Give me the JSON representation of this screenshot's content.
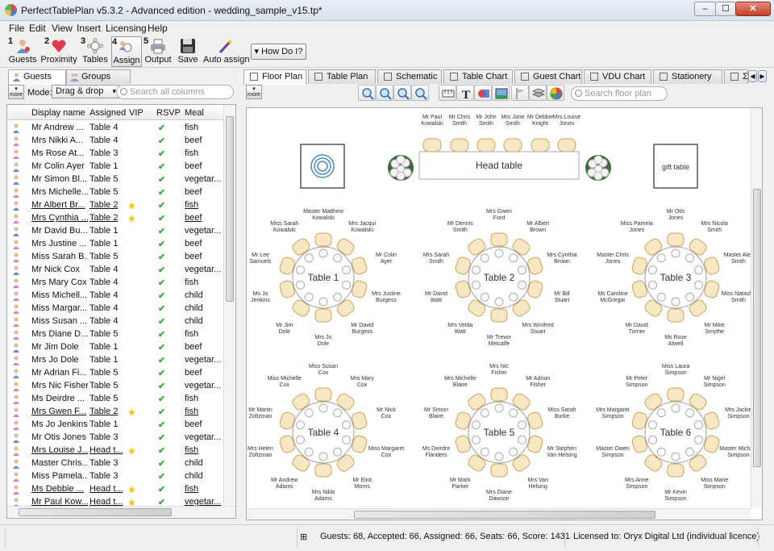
{
  "window": {
    "title": "PerfectTablePlan v5.3.2 - Advanced edition - wedding_sample_v15.tp*"
  },
  "menu": [
    "File",
    "Edit",
    "View",
    "Insert",
    "Licensing",
    "Help"
  ],
  "toolbar": [
    {
      "num": "1",
      "label": "Guests"
    },
    {
      "num": "2",
      "label": "Proximity"
    },
    {
      "num": "3",
      "label": "Tables"
    },
    {
      "num": "4",
      "label": "Assign"
    },
    {
      "num": "5",
      "label": "Output"
    },
    {
      "num": "",
      "label": "Save"
    },
    {
      "num": "",
      "label": "Auto assign"
    }
  ],
  "how_do_i": "▾ How Do I?",
  "left": {
    "tabs": [
      "Guests",
      "Groups"
    ],
    "more": "more",
    "mode_label": "Mode:",
    "mode_value": "Drag & drop",
    "search_placeholder": "Search all columns",
    "columns": [
      "Display name",
      "Assigned",
      "VIP",
      "RSVP",
      "Meal"
    ],
    "rows": [
      {
        "name": "Mr Andrew ...",
        "assigned": "Table 4",
        "vip": false,
        "meal": "fish",
        "gender": "m"
      },
      {
        "name": "Mrs Nikki A...",
        "assigned": "Table 4",
        "vip": false,
        "meal": "beef",
        "gender": "f"
      },
      {
        "name": "Ms Rose At...",
        "assigned": "Table 3",
        "vip": false,
        "meal": "fish",
        "gender": "f"
      },
      {
        "name": "Mr Colin Ayer",
        "assigned": "Table 1",
        "vip": false,
        "meal": "beef",
        "gender": "m"
      },
      {
        "name": "Mr Simon Bl...",
        "assigned": "Table 5",
        "vip": false,
        "meal": "vegetar...",
        "gender": "m"
      },
      {
        "name": "Mrs Michelle...",
        "assigned": "Table 5",
        "vip": false,
        "meal": "beef",
        "gender": "f"
      },
      {
        "name": "Mr Albert Br...",
        "assigned": "Table 2",
        "vip": true,
        "meal": "fish",
        "gender": "m",
        "u": true
      },
      {
        "name": "Mrs Cynthia ...",
        "assigned": "Table 2",
        "vip": true,
        "meal": "beef",
        "gender": "f",
        "u": true
      },
      {
        "name": "Mr David Bu...",
        "assigned": "Table 1",
        "vip": false,
        "meal": "vegetar...",
        "gender": "m"
      },
      {
        "name": "Mrs Justine ...",
        "assigned": "Table 1",
        "vip": false,
        "meal": "beef",
        "gender": "f"
      },
      {
        "name": "Miss Sarah B...",
        "assigned": "Table 5",
        "vip": false,
        "meal": "beef",
        "gender": "f"
      },
      {
        "name": "Mr Nick Cox",
        "assigned": "Table 4",
        "vip": false,
        "meal": "vegetar...",
        "gender": "m"
      },
      {
        "name": "Mrs Mary Cox",
        "assigned": "Table 4",
        "vip": false,
        "meal": "fish",
        "gender": "f"
      },
      {
        "name": "Miss Michell...",
        "assigned": "Table 4",
        "vip": false,
        "meal": "child",
        "gender": "f"
      },
      {
        "name": "Miss Margar...",
        "assigned": "Table 4",
        "vip": false,
        "meal": "child",
        "gender": "f"
      },
      {
        "name": "Miss Susan ...",
        "assigned": "Table 4",
        "vip": false,
        "meal": "child",
        "gender": "f"
      },
      {
        "name": "Mrs Diane D...",
        "assigned": "Table 5",
        "vip": false,
        "meal": "fish",
        "gender": "f"
      },
      {
        "name": "Mr Jim Dole",
        "assigned": "Table 1",
        "vip": false,
        "meal": "beef",
        "gender": "m"
      },
      {
        "name": "Mrs Jo Dole",
        "assigned": "Table 1",
        "vip": false,
        "meal": "vegetar...",
        "gender": "f"
      },
      {
        "name": "Mr Adrian Fi...",
        "assigned": "Table 5",
        "vip": false,
        "meal": "beef",
        "gender": "m"
      },
      {
        "name": "Mrs Nic Fisher",
        "assigned": "Table 5",
        "vip": false,
        "meal": "vegetar...",
        "gender": "f"
      },
      {
        "name": "Ms Deirdre ...",
        "assigned": "Table 5",
        "vip": false,
        "meal": "fish",
        "gender": "f"
      },
      {
        "name": "Mrs Gwen F...",
        "assigned": "Table 2",
        "vip": true,
        "meal": "fish",
        "gender": "f",
        "u": true
      },
      {
        "name": "Ms Jo Jenkins",
        "assigned": "Table 1",
        "vip": false,
        "meal": "beef",
        "gender": "f"
      },
      {
        "name": "Mr Otis Jones",
        "assigned": "Table 3",
        "vip": false,
        "meal": "vegetar...",
        "gender": "m"
      },
      {
        "name": "Mrs Louise J...",
        "assigned": "Head t...",
        "vip": true,
        "meal": "fish",
        "gender": "f",
        "u": true
      },
      {
        "name": "Master Chris...",
        "assigned": "Table 3",
        "vip": false,
        "meal": "child",
        "gender": "m"
      },
      {
        "name": "Miss Pamela...",
        "assigned": "Table 3",
        "vip": false,
        "meal": "child",
        "gender": "f"
      },
      {
        "name": "Ms Debbie ...",
        "assigned": "Head t...",
        "vip": true,
        "meal": "fish",
        "gender": "f",
        "u": true
      },
      {
        "name": "Mr Paul Kow...",
        "assigned": "Head t...",
        "vip": true,
        "meal": "vegetar...",
        "gender": "m",
        "u": true
      }
    ]
  },
  "right": {
    "tabs": [
      "Floor Plan",
      "Table Plan",
      "Schematic",
      "Table Chart",
      "Guest Chart",
      "VDU Chart",
      "Stationery",
      "Σ R"
    ],
    "more": "more",
    "search_placeholder": "Search floor plan",
    "head_table": {
      "label": "Head table",
      "guests": [
        "Mr Paul Kowalski",
        "Mr Chris Smith",
        "Mr John Smith",
        "Mrs Jane Smith",
        "Mr Debbie Knight",
        "Mrs Louise Jones"
      ]
    },
    "gift_table": "gift table",
    "round_tables": [
      {
        "label": "Table 1",
        "guests": [
          "Master Matthew Kowalski",
          "Mrs Jacqui Kowalski",
          "Mr Colin Ayer",
          "Mrs Justine Burgess",
          "Mr David Burgess",
          "Mrs Jo Dole",
          "Mr Jim Dole",
          "Ms Jo Jenkins",
          "Mr Lee Samuels",
          "Miss Sarah Kowalski"
        ]
      },
      {
        "label": "Table 2",
        "guests": [
          "Mrs Gwen Ford",
          "Mr Albert Brown",
          "Mrs Cynthia Brown",
          "Mr Bill Stuart",
          "Mrs Winifred Stuart",
          "Mr Trevor Metcalfe",
          "Mrs Velda Watt",
          "Mr David Watt",
          "Mrs Sarah Smith",
          "Mr Dennis Smith"
        ]
      },
      {
        "label": "Table 3",
        "guests": [
          "Mr Otis Jones",
          "Mrs Nicola Smith",
          "Master Alex Smith",
          "Miss Natasha Smith",
          "Mr Mike Smythe",
          "Ms Rose Atwell",
          "Mr David Turner",
          "Ms Caroline McGregor",
          "Master Chris Jones",
          "Miss Pamela Jones"
        ]
      },
      {
        "label": "Table 4",
        "guests": [
          "Miss Susan Cox",
          "Mrs Mary Cox",
          "Mr Nick Cox",
          "Miss Margaret Cox",
          "Mr Eliot Morris",
          "Mrs Nikki Adams",
          "Mr Andrew Adams",
          "Mrs Helen Zoltzman",
          "Mr Martin Zoltzman",
          "Miss Michelle Cox"
        ]
      },
      {
        "label": "Table 5",
        "guests": [
          "Mrs Nic Fisher",
          "Mr Adrian Fisher",
          "Miss Sarah Burke",
          "Mr Stephen Van Helsing",
          "Mrs Van Helsing",
          "Mrs Diane Dawson",
          "Mr Mark Parker",
          "Ms Deirdre Flanders",
          "Mr Simon Blaire",
          "Mrs Michelle Blaire"
        ]
      },
      {
        "label": "Table 6",
        "guests": [
          "Miss Laura Simpson",
          "Mr Nigel Simpson",
          "Mrs Jackie Simpson",
          "Master Michael Simpson",
          "Miss Marie Simpson",
          "Mr Kevin Simpson",
          "Mrs Anne Simpson",
          "Master Owen Simpson",
          "Mrs Margaret Simpson",
          "Mr Peter Simpson"
        ]
      }
    ]
  },
  "status": {
    "summary": "Guests: 68, Accepted: 66, Assigned: 66, Seats: 66, Score: 1431",
    "license": "Licensed to: Oryx Digital Ltd (individual licence)"
  },
  "colors": {
    "chair": "#f7e7c3",
    "chair_border": "#c9a45c",
    "rsvp_check": "#3aa845",
    "vip_star": "#f2c200"
  }
}
